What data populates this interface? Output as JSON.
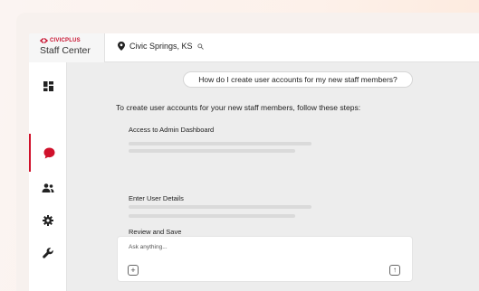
{
  "brand": {
    "logo_text": "CIVICPLUS",
    "title": "Staff Center"
  },
  "header": {
    "location": "Civic Springs, KS"
  },
  "sidebar": {
    "items": [
      {
        "icon": "dashboard-icon",
        "active": false
      },
      {
        "icon": "chat-bubble-icon",
        "active": true
      },
      {
        "icon": "people-icon",
        "active": false
      },
      {
        "icon": "gear-icon",
        "active": false
      },
      {
        "icon": "wrench-icon",
        "active": false
      }
    ]
  },
  "chat": {
    "question": "How do I create user accounts for my new staff members?",
    "answer_intro": "To create user accounts for your new staff members, follow these steps:",
    "steps": [
      {
        "title": "Access to Admin Dashboard"
      },
      {
        "title": "Enter User Details"
      },
      {
        "title": "Review and Save"
      }
    ]
  },
  "composer": {
    "placeholder": "Ask anything..."
  },
  "colors": {
    "accent": "#d0112b",
    "background": "#ededed"
  }
}
